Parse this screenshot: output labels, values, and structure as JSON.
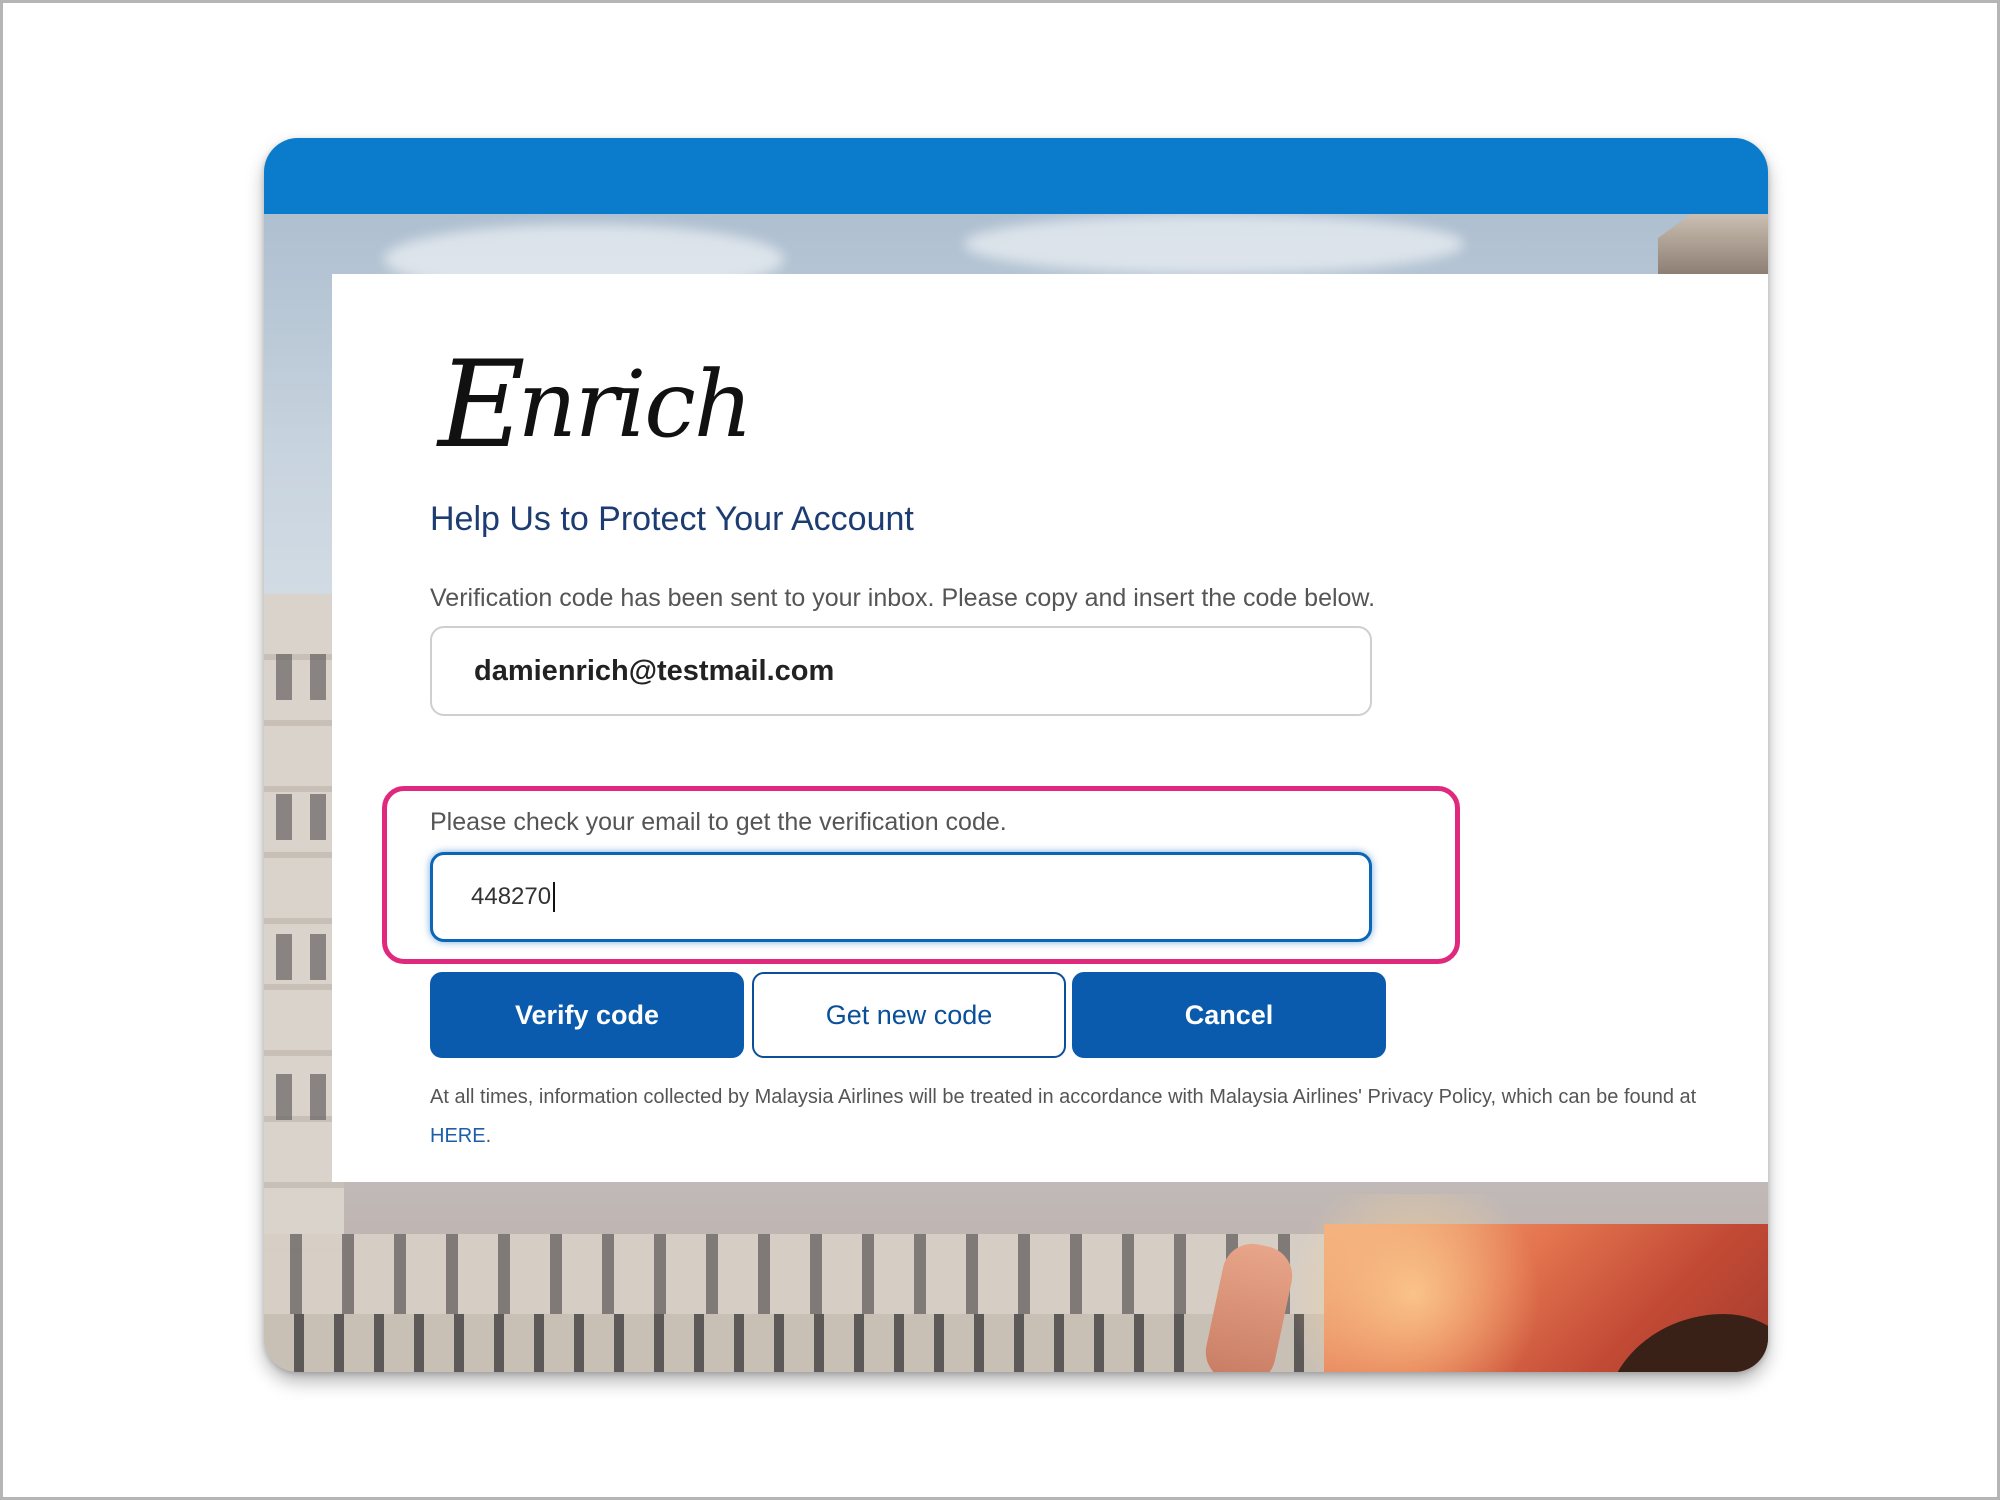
{
  "brand": {
    "logo_initial": "E",
    "logo_rest": "nrich",
    "header_color": "#0a7ccb",
    "button_color": "#0a5aad",
    "highlight_color": "#e0297d"
  },
  "page": {
    "title": "Help Us to Protect Your Account",
    "info_text": "Verification code has been sent to your inbox. Please copy and insert the code below.",
    "email_value": "damienrich@testmail.com",
    "hint_text": "Please check your email to get the verification code.",
    "code_value": "448270"
  },
  "buttons": {
    "verify_label": "Verify code",
    "new_code_label": "Get new code",
    "cancel_label": "Cancel"
  },
  "disclaimer": {
    "text": "At all times, information collected by Malaysia Airlines will be treated in accordance with Malaysia Airlines' Privacy Policy, which can be found at",
    "link_label": "HERE",
    "suffix": "."
  }
}
